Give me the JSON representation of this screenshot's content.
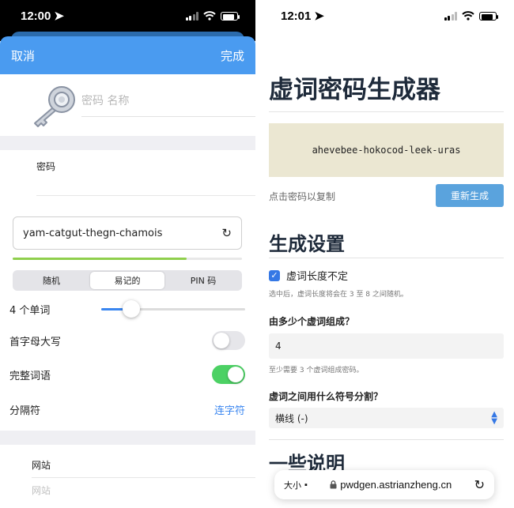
{
  "left": {
    "status": {
      "time": "12:00"
    },
    "nav": {
      "cancel": "取消",
      "done": "完成"
    },
    "name_placeholder": "密码 名称",
    "password_label": "密码",
    "generated_password": "yam-catgut-thegn-chamois",
    "strength": 0.76,
    "segments": [
      {
        "label": "随机",
        "selected": false
      },
      {
        "label": "易记的",
        "selected": true
      },
      {
        "label": "PIN 码",
        "selected": false
      }
    ],
    "word_count_label": "4 个单词",
    "word_slider_value": 0.17,
    "capitalize_label": "首字母大写",
    "capitalize_on": false,
    "full_words_label": "完整词语",
    "full_words_on": true,
    "separator_label": "分隔符",
    "separator_value": "连字符",
    "website_label": "网站",
    "website_placeholder": "网站"
  },
  "right": {
    "status": {
      "time": "12:01"
    },
    "title": "虚词密码生成器",
    "generated_password": "ahevebee-hokocod-leek-uras",
    "copy_hint": "点击密码以复制",
    "regenerate": "重新生成",
    "settings_heading": "生成设置",
    "variable_length_label": "虚词长度不定",
    "variable_length_checked": true,
    "variable_length_hint": "选中后，虚词长度将会在 3 至 8 之间随机。",
    "count_question": "由多少个虚词组成？",
    "count_value": "4",
    "count_hint": "至少需要 3 个虚词组成密码。",
    "separator_question": "虚词之间用什么符号分割？",
    "separator_value": "横线 (-)",
    "notes_heading": "一些说明",
    "url_bar": {
      "text_size": "大小",
      "url": "pwdgen.astrianzheng.cn"
    }
  },
  "colors": {
    "ios_blue": "#4a9bf0",
    "toggle_green": "#4cd164",
    "regen_button": "#5aa3dd",
    "password_box": "#ebe7d2"
  }
}
